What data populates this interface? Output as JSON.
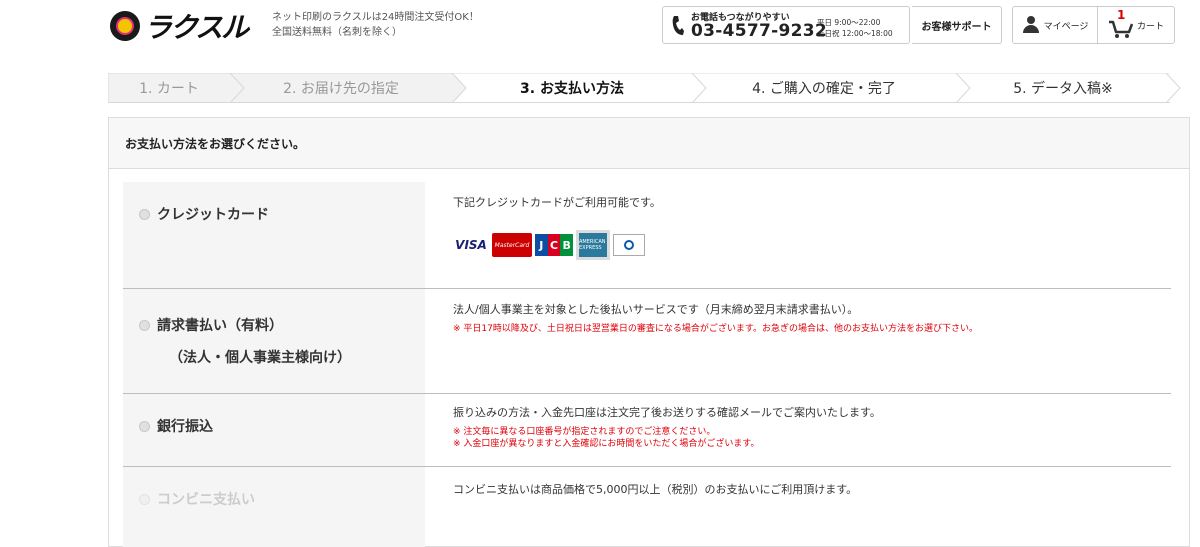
{
  "header": {
    "logo_text": "ラクスル",
    "tagline_line1": "ネット印刷のラクスルは24時間注文受付OK！",
    "tagline_line2": "全国送料無料（名刺を除く）",
    "phone_label": "お電話もつながりやすい",
    "phone_number": "03-4577-9232",
    "hours_line1": "平日 9:00〜22:00",
    "hours_line2": "土日祝 12:00〜18:00",
    "support_label": "お客様サポート",
    "mypage_label": "マイページ",
    "cart_label": "カート",
    "cart_count": "1"
  },
  "steps": [
    {
      "label": "1. カート",
      "state": "done"
    },
    {
      "label": "2. お届け先の指定",
      "state": "done"
    },
    {
      "label": "3. お支払い方法",
      "state": "active"
    },
    {
      "label": "4. ご購入の確定・完了",
      "state": "todo"
    },
    {
      "label": "5. データ入稿※",
      "state": "todo"
    }
  ],
  "panel": {
    "heading": "お支払い方法をお選びください。",
    "options": [
      {
        "label": "クレジットカード",
        "description": "下記クレジットカードがご利用可能です。",
        "cards": [
          "VISA",
          "MasterCard",
          "JCB",
          "AMERICAN EXPRESS",
          "Diners Club INTERNATIONAL"
        ]
      },
      {
        "label": "請求書払い（有料）",
        "sub_label": "（法人・個人事業主様向け）",
        "description": "法人/個人事業主を対象とした後払いサービスです（月末締め翌月末請求書払い）。",
        "note": "※ 平日17時以降及び、土日祝日は翌営業日の審査になる場合がございます。お急ぎの場合は、他のお支払い方法をお選び下さい。"
      },
      {
        "label": "銀行振込",
        "description": "振り込みの方法・入金先口座は注文完了後お送りする確認メールでご案内いたします。",
        "note1": "※ 注文毎に異なる口座番号が指定されますのでご注意ください。",
        "note2": "※ 入金口座が異なりますと入金確認にお時間をいただく場合がございます。"
      },
      {
        "label": "コンビニ支払い",
        "description": "コンビニ支払いは商品価格で5,000円以上（税別）のお支払いにご利用頂けます。",
        "disabled": true
      }
    ]
  },
  "colors": {
    "note_red": "#e0000a",
    "row_left_bg": "#f5f5f5",
    "active_step_text": "#111111"
  }
}
